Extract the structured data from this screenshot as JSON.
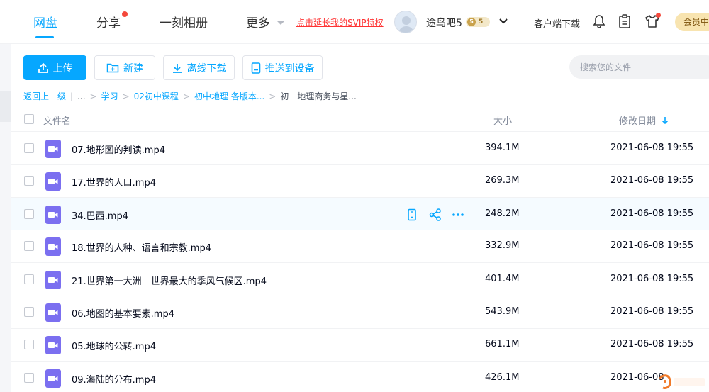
{
  "header": {
    "nav": [
      {
        "label": "网盘",
        "active": true
      },
      {
        "label": "分享",
        "has_dot": true
      },
      {
        "label": "一刻相册"
      },
      {
        "label": "更多"
      }
    ],
    "svip_promo": "点击延长我的SVIP特权",
    "username": "途鸟吧5",
    "level": "5",
    "level_num": "5",
    "client_download": "客户端下载",
    "vip_button": "会员中"
  },
  "toolbar": {
    "upload": "上传",
    "new": "新建",
    "offline_download": "离线下载",
    "push_device": "推送到设备",
    "search_placeholder": "搜索您的文件"
  },
  "breadcrumb": {
    "back": "返回上一级",
    "ellipsis": "...",
    "items": [
      "学习",
      "02初中课程",
      "初中地理 各版本...",
      "初一地理商务与星..."
    ]
  },
  "table": {
    "headers": {
      "name": "文件名",
      "size": "大小",
      "date": "修改日期"
    },
    "rows": [
      {
        "name": "07.地形图的判读.mp4",
        "size": "394.1M",
        "date": "2021-06-08 19:55"
      },
      {
        "name": "17.世界的人口.mp4",
        "size": "269.3M",
        "date": "2021-06-08 19:55"
      },
      {
        "name": "34.巴西.mp4",
        "size": "248.2M",
        "date": "2021-06-08 19:55",
        "hover": true
      },
      {
        "name": "18.世界的人种、语言和宗教.mp4",
        "size": "332.9M",
        "date": "2021-06-08 19:55"
      },
      {
        "name": "21.世界第一大洲　世界最大的季风气候区.mp4",
        "size": "401.4M",
        "date": "2021-06-08 19:55"
      },
      {
        "name": "06.地图的基本要素.mp4",
        "size": "543.9M",
        "date": "2021-06-08 19:55"
      },
      {
        "name": "05.地球的公转.mp4",
        "size": "661.1M",
        "date": "2021-06-08 19:55"
      },
      {
        "name": "09.海陆的分布.mp4",
        "size": "426.1M",
        "date": "2021-06-08"
      }
    ]
  },
  "colors": {
    "accent": "#06a7ff",
    "video_icon": "#7b6ff0",
    "promo_red": "#ff3333"
  }
}
